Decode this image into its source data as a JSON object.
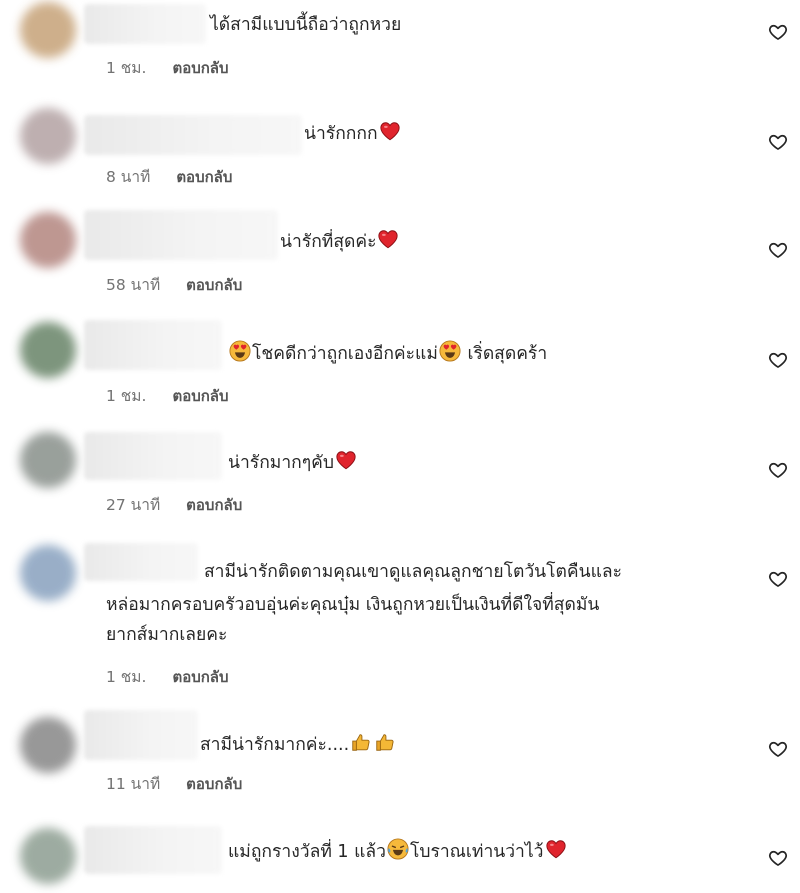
{
  "comments": [
    {
      "text": "ได้สามีแบบนี้ถือว่าถูกหวย",
      "time": "1 ชม.",
      "reply": "ตอบกลับ",
      "avatar_color": "#c9a77f"
    },
    {
      "text": "น่ารักกกก",
      "time": "8 นาที",
      "reply": "ตอบกลับ",
      "avatar_color": "#b7a7a8"
    },
    {
      "text": "น่ารักที่สุดค่ะ",
      "time": "58 นาที",
      "reply": "ตอบกลับ",
      "avatar_color": "#b78c86"
    },
    {
      "text_a": "โชคดีกว่าถูกเองอีกค่ะแม่",
      "text_b": "เริ่ดสุดคร้า",
      "time": "1 ชม.",
      "reply": "ตอบกลับ",
      "avatar_color": "#6f8a6f"
    },
    {
      "text": "น่ารักมากๆคับ",
      "time": "27 นาที",
      "reply": "ตอบกลับ",
      "avatar_color": "#8f9691"
    },
    {
      "lines": [
        "สามีน่ารักติดตามคุณเขาดูแลคุณลูกชายโตวันโตคืนและ",
        "หล่อมากครอบครัวอบอุ่นค่ะคุณบุ๋ม เงินถูกหวยเป็นเงินที่ดีใจที่สุดมัน",
        "ยากส์มากเลยคะ"
      ],
      "time": "1 ชม.",
      "reply": "ตอบกลับ",
      "avatar_color": "#8ea6c2"
    },
    {
      "text": "สามีน่ารักมากค่ะ....",
      "time": "11 นาที",
      "reply": "ตอบกลับ",
      "avatar_color": "#8d8d8d"
    },
    {
      "text_a": "แม่ถูกรางวัลที่ 1 แล้ว",
      "text_b": "โบราณเท่านว่าไว้",
      "avatar_color": "#93a397"
    }
  ],
  "icons": {
    "like": "heart-outline-icon",
    "heart_emoji": "red-heart-emoji",
    "heart_eyes": "heart-eyes-emoji",
    "thumbs": "thumbs-up-emoji",
    "tears": "tears-of-joy-emoji"
  }
}
